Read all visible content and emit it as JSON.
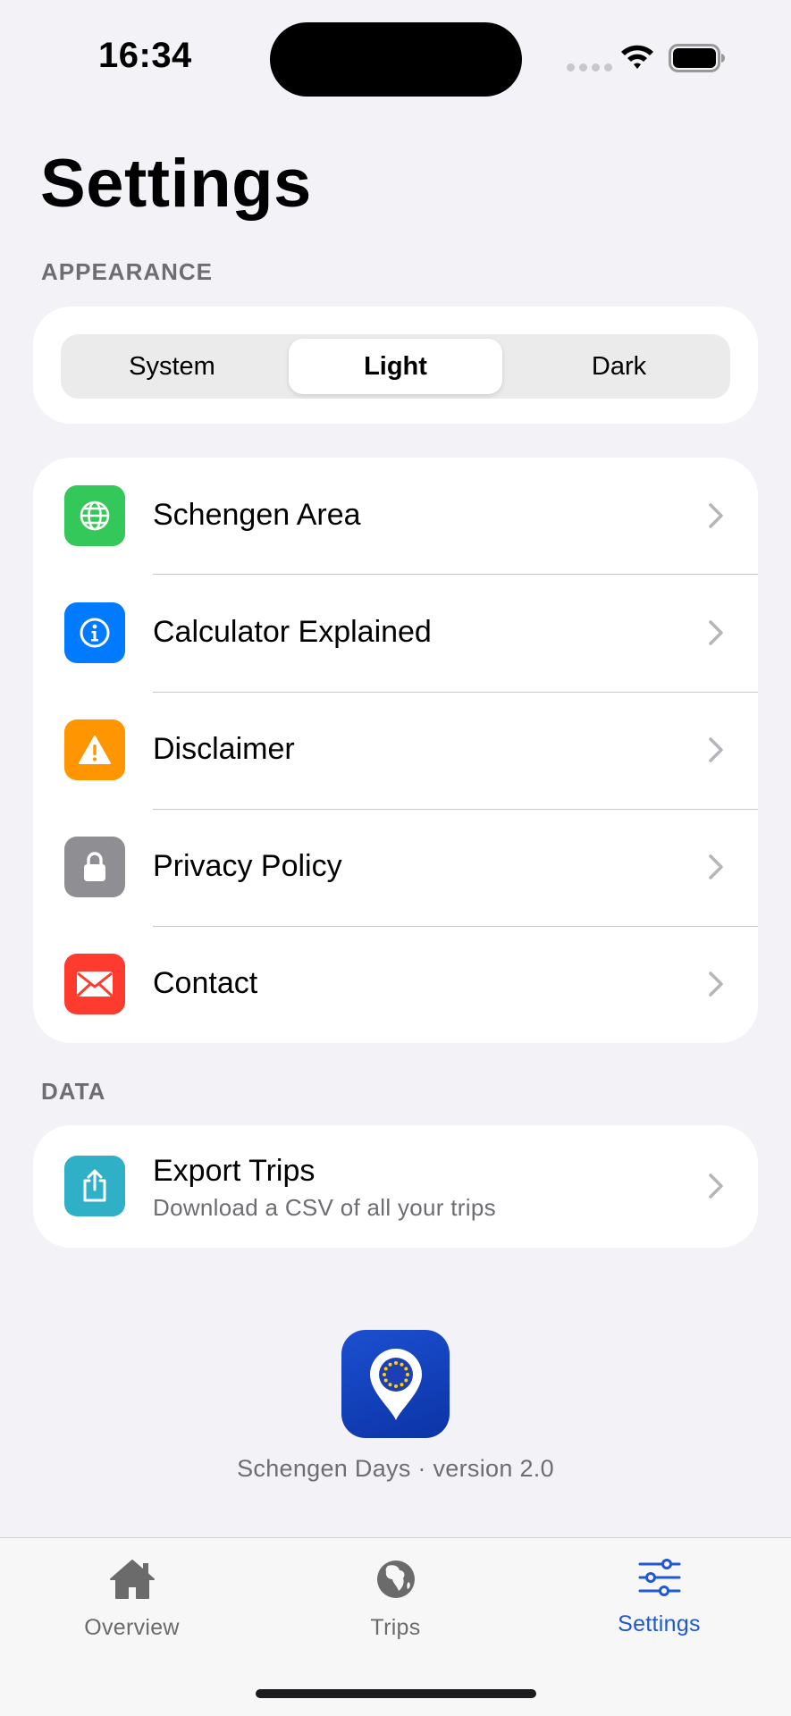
{
  "status_bar": {
    "time": "16:34"
  },
  "page_title": "Settings",
  "appearance": {
    "header": "APPEARANCE",
    "options": [
      "System",
      "Light",
      "Dark"
    ],
    "selected": "Light"
  },
  "info_rows": [
    {
      "label": "Schengen Area",
      "icon": "globe-icon",
      "color": "#34c759"
    },
    {
      "label": "Calculator Explained",
      "icon": "info-icon",
      "color": "#007aff"
    },
    {
      "label": "Disclaimer",
      "icon": "warning-icon",
      "color": "#ff9500"
    },
    {
      "label": "Privacy Policy",
      "icon": "lock-icon",
      "color": "#8e8e93"
    },
    {
      "label": "Contact",
      "icon": "envelope-icon",
      "color": "#ff3b30"
    }
  ],
  "data_section": {
    "header": "DATA",
    "export_title": "Export Trips",
    "export_subtitle": "Download a CSV of all your trips",
    "icon": "share-icon",
    "color": "#30b0c7"
  },
  "app_footer": {
    "version_text": "Schengen Days · version 2.0"
  },
  "tab_bar": {
    "tabs": [
      {
        "label": "Overview",
        "icon": "house-icon"
      },
      {
        "label": "Trips",
        "icon": "globe-africa-icon"
      },
      {
        "label": "Settings",
        "icon": "sliders-icon"
      }
    ],
    "active": "Settings",
    "accent_color": "#2157d0"
  }
}
